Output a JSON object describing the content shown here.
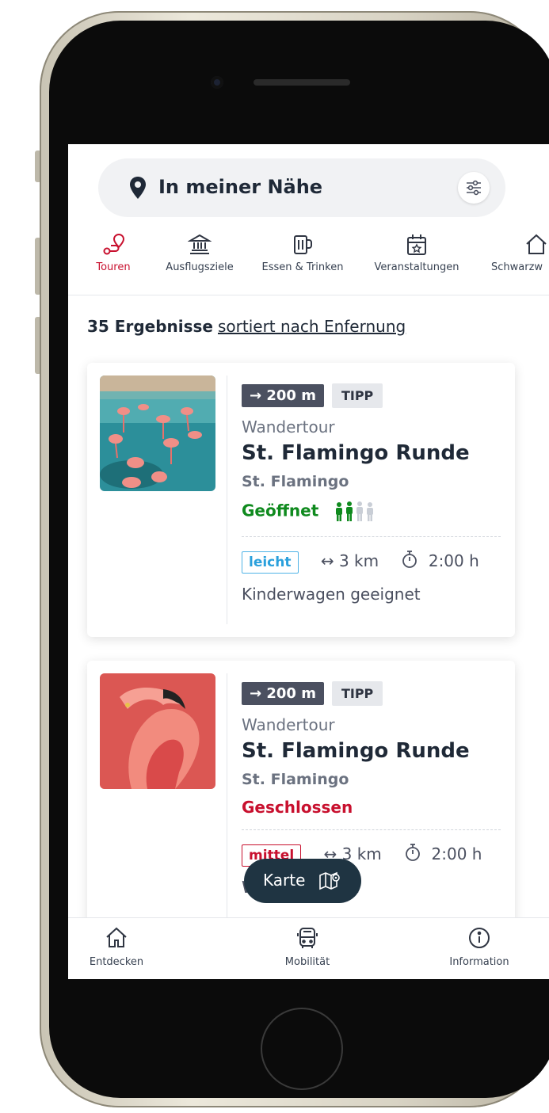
{
  "search": {
    "label": "In meiner Nähe"
  },
  "categories": [
    {
      "label": "Touren",
      "active": true
    },
    {
      "label": "Ausflugsziele"
    },
    {
      "label": "Essen & Trinken"
    },
    {
      "label": "Veranstaltungen"
    },
    {
      "label": "Schwarzw"
    }
  ],
  "results": {
    "count": "35 Ergebnisse",
    "sort": "sortiert nach Enfernung"
  },
  "cards": [
    {
      "distance": "→ 200 m",
      "badge": "TIPP",
      "type": "Wandertour",
      "title": "St. Flamingo Runde",
      "place": "St. Flamingo",
      "status": "Geöffnet",
      "difficulty": "leicht",
      "length": "↔ 3 km",
      "duration": "2:00 h",
      "feature": "Kinderwagen geeignet",
      "occupancy": 0.5
    },
    {
      "distance": "→ 200 m",
      "badge": "TIPP",
      "type": "Wandertour",
      "title": "St. Flamingo Runde",
      "place": "St. Flamingo",
      "status": "Geschlossen",
      "difficulty": "mittel",
      "length": "↔ 3 km",
      "duration": "2:00 h",
      "feature": "Wege geräumt"
    }
  ],
  "map_button": {
    "label": "Karte"
  },
  "tabbar": [
    {
      "label": "Entdecken"
    },
    {
      "label": "Mobilität"
    },
    {
      "label": "Information"
    }
  ],
  "colors": {
    "accent": "#c8102e",
    "open": "#0f8a1e",
    "easy": "#2aa0dc",
    "dark": "#1f3442"
  }
}
